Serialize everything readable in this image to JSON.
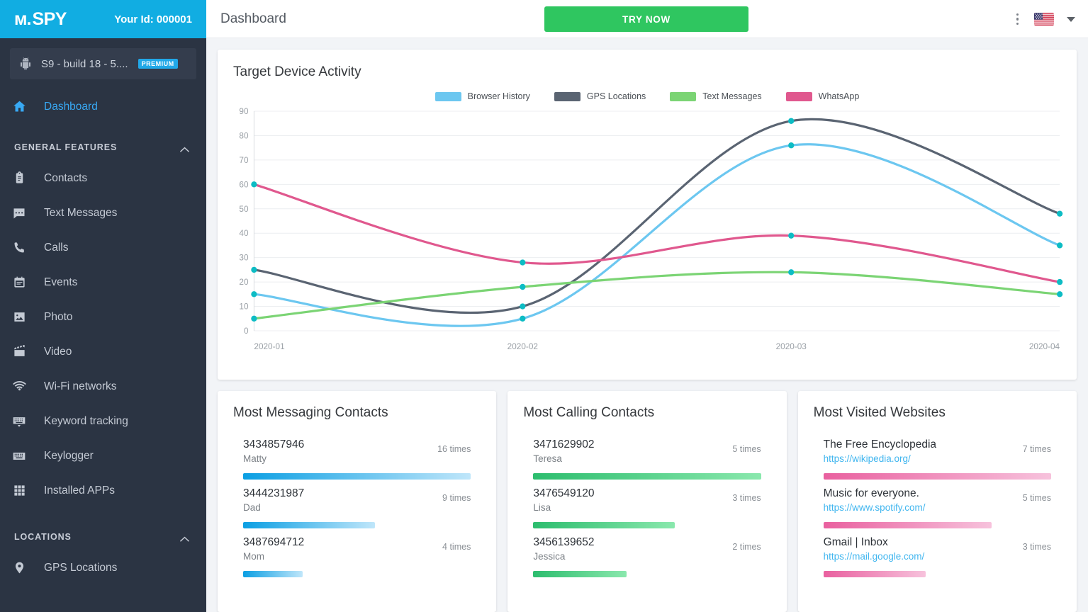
{
  "brand": {
    "logo_m": "м.",
    "logo_spy": "SPY",
    "your_id": "Your Id: 000001"
  },
  "device": {
    "name": "S9 - build 18 - 5....",
    "badge": "PREMIUM",
    "icon": "android-icon"
  },
  "topbar": {
    "page_title": "Dashboard",
    "try_now": "TRY NOW",
    "menu_icon": "kebab-menu-icon",
    "flag_icon": "us-flag-icon",
    "caret_icon": "chevron-down-icon"
  },
  "sidebar": {
    "dashboard": {
      "label": "Dashboard",
      "icon": "home-icon"
    },
    "groups": [
      {
        "label": "GENERAL FEATURES",
        "icon": "chevron-up-icon"
      },
      {
        "label": "LOCATIONS",
        "icon": "chevron-up-icon"
      }
    ],
    "general_items": [
      {
        "label": "Contacts",
        "icon": "contacts-icon"
      },
      {
        "label": "Text Messages",
        "icon": "message-icon"
      },
      {
        "label": "Calls",
        "icon": "phone-icon"
      },
      {
        "label": "Events",
        "icon": "calendar-icon"
      },
      {
        "label": "Photo",
        "icon": "photo-icon"
      },
      {
        "label": "Video",
        "icon": "video-icon"
      },
      {
        "label": "Wi-Fi networks",
        "icon": "wifi-icon"
      },
      {
        "label": "Keyword tracking",
        "icon": "keyword-icon"
      },
      {
        "label": "Keylogger",
        "icon": "keyboard-icon"
      },
      {
        "label": "Installed APPs",
        "icon": "apps-grid-icon"
      }
    ],
    "location_items": [
      {
        "label": "GPS Locations",
        "icon": "map-pin-icon"
      }
    ]
  },
  "chart_data": {
    "type": "line",
    "title": "Target Device Activity",
    "categories": [
      "2020-01",
      "2020-02",
      "2020-03",
      "2020-04"
    ],
    "xlabel": "",
    "ylabel": "",
    "ylim": [
      0,
      90
    ],
    "yticks": [
      0,
      10,
      20,
      30,
      40,
      50,
      60,
      70,
      80,
      90
    ],
    "grid": true,
    "legend_position": "top-center",
    "point_color": "#0dbcc4",
    "series": [
      {
        "name": "Browser History",
        "color": "#6cc7f0",
        "values": [
          15,
          5,
          76,
          35
        ]
      },
      {
        "name": "GPS Locations",
        "color": "#5a6472",
        "values": [
          25,
          10,
          86,
          48
        ]
      },
      {
        "name": "Text Messages",
        "color": "#7bd474",
        "values": [
          5,
          18,
          24,
          15
        ]
      },
      {
        "name": "WhatsApp",
        "color": "#e0588e",
        "values": [
          60,
          28,
          39,
          20
        ]
      }
    ]
  },
  "panels": {
    "messaging": {
      "title": "Most Messaging Contacts",
      "bar_from": "#0b9fe3",
      "bar_to": "#bfe6fa",
      "rows": [
        {
          "primary": "3434857946",
          "secondary": "Matty",
          "count": "16 times",
          "pct": 100
        },
        {
          "primary": "3444231987",
          "secondary": "Dad",
          "count": "9 times",
          "pct": 58
        },
        {
          "primary": "3487694712",
          "secondary": "Mom",
          "count": "4 times",
          "pct": 26
        }
      ]
    },
    "calling": {
      "title": "Most Calling Contacts",
      "bar_from": "#2cbd6e",
      "bar_to": "#8ae8ad",
      "rows": [
        {
          "primary": "3471629902",
          "secondary": "Teresa",
          "count": "5 times",
          "pct": 100
        },
        {
          "primary": "3476549120",
          "secondary": "Lisa",
          "count": "3 times",
          "pct": 62
        },
        {
          "primary": "3456139652",
          "secondary": "Jessica",
          "count": "2 times",
          "pct": 41
        }
      ]
    },
    "websites": {
      "title": "Most Visited Websites",
      "bar_from": "#e9609f",
      "bar_to": "#f7c2dc",
      "rows": [
        {
          "primary": "The Free Encyclopedia",
          "secondary": "https://wikipedia.org/",
          "count": "7 times",
          "pct": 100
        },
        {
          "primary": "Music for everyone.",
          "secondary": "https://www.spotify.com/",
          "count": "5 times",
          "pct": 74
        },
        {
          "primary": "Gmail | Inbox",
          "secondary": "https://mail.google.com/",
          "count": "3 times",
          "pct": 45
        }
      ]
    }
  }
}
